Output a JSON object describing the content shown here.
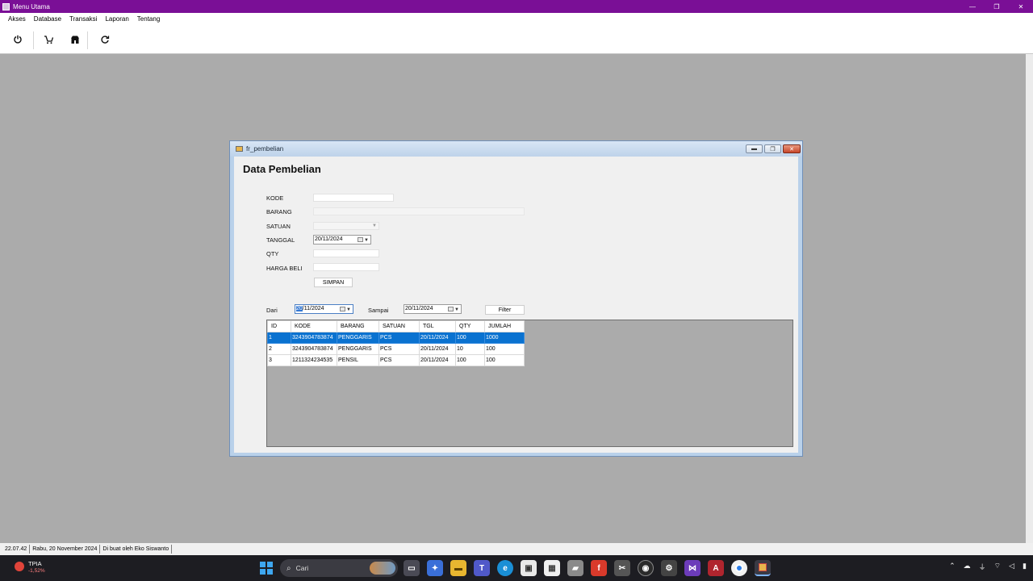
{
  "window": {
    "title": "Menu Utama",
    "minimize": "—",
    "maximize": "❐",
    "close": "✕"
  },
  "menu": [
    "Akses",
    "Database",
    "Transaksi",
    "Laporan",
    "Tentang"
  ],
  "toolbar": {
    "icons": [
      "power-icon",
      "cart-icon",
      "shop-icon",
      "refresh-icon"
    ]
  },
  "form": {
    "title": "fr_pembelian",
    "heading": "Data Pembelian",
    "labels": {
      "kode": "KODE",
      "barang": "BARANG",
      "satuan": "SATUAN",
      "tanggal": "TANGGAL",
      "qty": "QTY",
      "harga_beli": "HARGA BELI"
    },
    "tanggal_value": "20/11/2024",
    "simpan_label": "SIMPAN",
    "filter": {
      "dari_label": "Dari",
      "dari_value_sel": "20",
      "dari_value_rest": "/11/2024",
      "sampai_label": "Sampai",
      "sampai_value": "20/11/2024",
      "button_label": "Filter"
    },
    "grid": {
      "columns": [
        "ID",
        "KODE",
        "BARANG",
        "SATUAN",
        "TGL",
        "QTY",
        "JUMLAH"
      ],
      "rows": [
        [
          "1",
          "3243904783874",
          "PENGGARIS",
          "PCS",
          "20/11/2024",
          "100",
          "1000"
        ],
        [
          "2",
          "3243904783874",
          "PENGGARIS",
          "PCS",
          "20/11/2024",
          "10",
          "100"
        ],
        [
          "3",
          "1211324234535",
          "PENSIL",
          "PCS",
          "20/11/2024",
          "100",
          "100"
        ]
      ],
      "selected_row": 0
    }
  },
  "status": {
    "time": "22.07.42",
    "date": "Rabu, 20 November 2024",
    "author": "Di buat oleh Eko Siswanto"
  },
  "taskbar": {
    "stock_name": "TPIA",
    "stock_change": "-1,52%",
    "search_label": "Cari",
    "colors": {
      "accent": "#7a0f96",
      "selection": "#0a72d0"
    }
  }
}
